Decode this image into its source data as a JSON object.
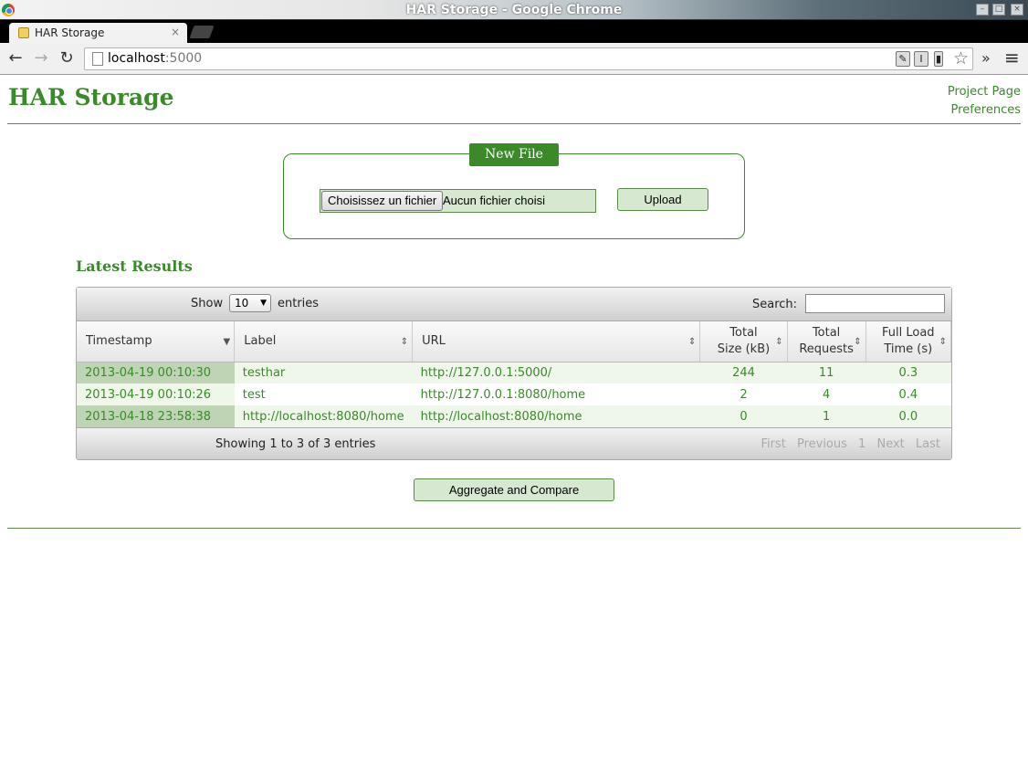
{
  "window": {
    "title": "HAR Storage - Google Chrome"
  },
  "browser": {
    "tab_title": "HAR Storage",
    "tab_close": "×",
    "url_host": "localhost",
    "url_port": ":5000",
    "icons": {
      "back": "←",
      "forward": "→",
      "reload": "↻",
      "star": "☆",
      "overflow": "»",
      "menu": "≡",
      "ext1": "✎",
      "ext2": "I",
      "ext3": "▮"
    }
  },
  "header": {
    "site_title": "HAR Storage",
    "links": [
      "Project Page",
      "Preferences"
    ]
  },
  "new_file": {
    "legend": "New File",
    "choose_label": "Choisissez un fichier",
    "no_file_label": "Aucun fichier choisi",
    "upload_label": "Upload"
  },
  "latest": {
    "title": "Latest Results",
    "show_label": "Show",
    "entries_selected": "10",
    "entries_label": "entries",
    "search_label": "Search:",
    "search_value": "",
    "columns": [
      {
        "line1": "Timestamp",
        "line2": ""
      },
      {
        "line1": "Label",
        "line2": ""
      },
      {
        "line1": "URL",
        "line2": ""
      },
      {
        "line1": "Total",
        "line2": "Size (kB)"
      },
      {
        "line1": "Total",
        "line2": "Requests"
      },
      {
        "line1": "Full Load",
        "line2": "Time (s)"
      }
    ],
    "rows": [
      {
        "timestamp": "2013-04-19 00:10:30",
        "label": "testhar",
        "url": "http://127.0.0.1:5000/",
        "size": "244",
        "requests": "11",
        "time": "0.3"
      },
      {
        "timestamp": "2013-04-19 00:10:26",
        "label": "test",
        "url": "http://127.0.0.1:8080/home",
        "size": "2",
        "requests": "4",
        "time": "0.4"
      },
      {
        "timestamp": "2013-04-18 23:58:38",
        "label": "http://localhost:8080/home",
        "url": "http://localhost:8080/home",
        "size": "0",
        "requests": "1",
        "time": "0.0"
      }
    ],
    "info": "Showing 1 to 3 of 3 entries",
    "pager": {
      "first": "First",
      "previous": "Previous",
      "page": "1",
      "next": "Next",
      "last": "Last"
    }
  },
  "aggregate_label": "Aggregate and Compare",
  "colors": {
    "accent": "#3a8a2a",
    "row_highlight": "#eef7ea",
    "button_bg": "#d6e8d0"
  }
}
